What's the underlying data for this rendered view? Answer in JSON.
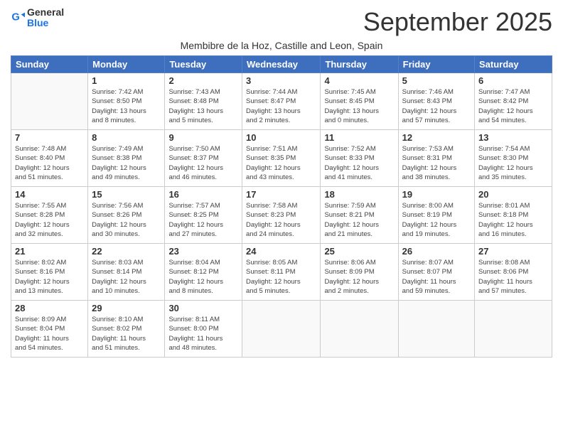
{
  "header": {
    "logo_line1": "General",
    "logo_line2": "Blue",
    "month": "September 2025",
    "location": "Membibre de la Hoz, Castille and Leon, Spain"
  },
  "weekdays": [
    "Sunday",
    "Monday",
    "Tuesday",
    "Wednesday",
    "Thursday",
    "Friday",
    "Saturday"
  ],
  "weeks": [
    [
      {
        "day": "",
        "info": ""
      },
      {
        "day": "1",
        "info": "Sunrise: 7:42 AM\nSunset: 8:50 PM\nDaylight: 13 hours\nand 8 minutes."
      },
      {
        "day": "2",
        "info": "Sunrise: 7:43 AM\nSunset: 8:48 PM\nDaylight: 13 hours\nand 5 minutes."
      },
      {
        "day": "3",
        "info": "Sunrise: 7:44 AM\nSunset: 8:47 PM\nDaylight: 13 hours\nand 2 minutes."
      },
      {
        "day": "4",
        "info": "Sunrise: 7:45 AM\nSunset: 8:45 PM\nDaylight: 13 hours\nand 0 minutes."
      },
      {
        "day": "5",
        "info": "Sunrise: 7:46 AM\nSunset: 8:43 PM\nDaylight: 12 hours\nand 57 minutes."
      },
      {
        "day": "6",
        "info": "Sunrise: 7:47 AM\nSunset: 8:42 PM\nDaylight: 12 hours\nand 54 minutes."
      }
    ],
    [
      {
        "day": "7",
        "info": "Sunrise: 7:48 AM\nSunset: 8:40 PM\nDaylight: 12 hours\nand 51 minutes."
      },
      {
        "day": "8",
        "info": "Sunrise: 7:49 AM\nSunset: 8:38 PM\nDaylight: 12 hours\nand 49 minutes."
      },
      {
        "day": "9",
        "info": "Sunrise: 7:50 AM\nSunset: 8:37 PM\nDaylight: 12 hours\nand 46 minutes."
      },
      {
        "day": "10",
        "info": "Sunrise: 7:51 AM\nSunset: 8:35 PM\nDaylight: 12 hours\nand 43 minutes."
      },
      {
        "day": "11",
        "info": "Sunrise: 7:52 AM\nSunset: 8:33 PM\nDaylight: 12 hours\nand 41 minutes."
      },
      {
        "day": "12",
        "info": "Sunrise: 7:53 AM\nSunset: 8:31 PM\nDaylight: 12 hours\nand 38 minutes."
      },
      {
        "day": "13",
        "info": "Sunrise: 7:54 AM\nSunset: 8:30 PM\nDaylight: 12 hours\nand 35 minutes."
      }
    ],
    [
      {
        "day": "14",
        "info": "Sunrise: 7:55 AM\nSunset: 8:28 PM\nDaylight: 12 hours\nand 32 minutes."
      },
      {
        "day": "15",
        "info": "Sunrise: 7:56 AM\nSunset: 8:26 PM\nDaylight: 12 hours\nand 30 minutes."
      },
      {
        "day": "16",
        "info": "Sunrise: 7:57 AM\nSunset: 8:25 PM\nDaylight: 12 hours\nand 27 minutes."
      },
      {
        "day": "17",
        "info": "Sunrise: 7:58 AM\nSunset: 8:23 PM\nDaylight: 12 hours\nand 24 minutes."
      },
      {
        "day": "18",
        "info": "Sunrise: 7:59 AM\nSunset: 8:21 PM\nDaylight: 12 hours\nand 21 minutes."
      },
      {
        "day": "19",
        "info": "Sunrise: 8:00 AM\nSunset: 8:19 PM\nDaylight: 12 hours\nand 19 minutes."
      },
      {
        "day": "20",
        "info": "Sunrise: 8:01 AM\nSunset: 8:18 PM\nDaylight: 12 hours\nand 16 minutes."
      }
    ],
    [
      {
        "day": "21",
        "info": "Sunrise: 8:02 AM\nSunset: 8:16 PM\nDaylight: 12 hours\nand 13 minutes."
      },
      {
        "day": "22",
        "info": "Sunrise: 8:03 AM\nSunset: 8:14 PM\nDaylight: 12 hours\nand 10 minutes."
      },
      {
        "day": "23",
        "info": "Sunrise: 8:04 AM\nSunset: 8:12 PM\nDaylight: 12 hours\nand 8 minutes."
      },
      {
        "day": "24",
        "info": "Sunrise: 8:05 AM\nSunset: 8:11 PM\nDaylight: 12 hours\nand 5 minutes."
      },
      {
        "day": "25",
        "info": "Sunrise: 8:06 AM\nSunset: 8:09 PM\nDaylight: 12 hours\nand 2 minutes."
      },
      {
        "day": "26",
        "info": "Sunrise: 8:07 AM\nSunset: 8:07 PM\nDaylight: 11 hours\nand 59 minutes."
      },
      {
        "day": "27",
        "info": "Sunrise: 8:08 AM\nSunset: 8:06 PM\nDaylight: 11 hours\nand 57 minutes."
      }
    ],
    [
      {
        "day": "28",
        "info": "Sunrise: 8:09 AM\nSunset: 8:04 PM\nDaylight: 11 hours\nand 54 minutes."
      },
      {
        "day": "29",
        "info": "Sunrise: 8:10 AM\nSunset: 8:02 PM\nDaylight: 11 hours\nand 51 minutes."
      },
      {
        "day": "30",
        "info": "Sunrise: 8:11 AM\nSunset: 8:00 PM\nDaylight: 11 hours\nand 48 minutes."
      },
      {
        "day": "",
        "info": ""
      },
      {
        "day": "",
        "info": ""
      },
      {
        "day": "",
        "info": ""
      },
      {
        "day": "",
        "info": ""
      }
    ]
  ]
}
